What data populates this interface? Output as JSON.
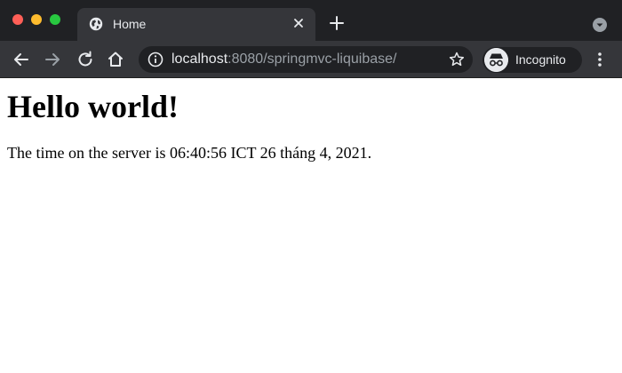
{
  "tab": {
    "title": "Home",
    "icon": "globe-icon"
  },
  "toolbar": {
    "url_host": "localhost",
    "url_rest": ":8080/springmvc-liquibase/",
    "profile_label": "Incognito"
  },
  "page": {
    "heading": "Hello world!",
    "paragraph": "The time on the server is 06:40:56 ICT 26 tháng 4, 2021."
  },
  "colors": {
    "frame": "#202124",
    "toolbar": "#35363a",
    "close_light": "#ff5f57",
    "minimize_light": "#febc2e",
    "maximize_light": "#28c840"
  }
}
